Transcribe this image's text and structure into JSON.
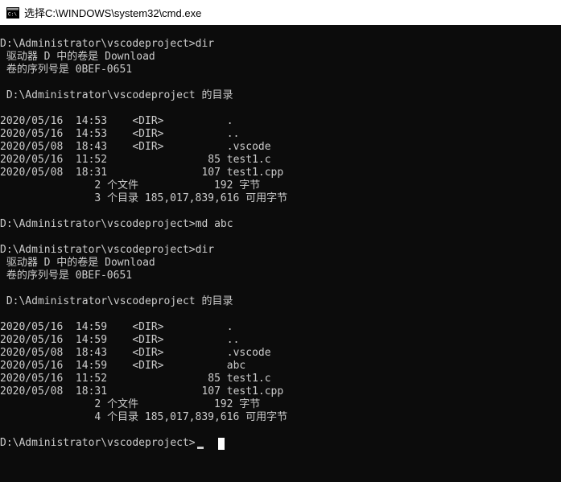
{
  "window": {
    "title": "选择C:\\WINDOWS\\system32\\cmd.exe",
    "icon": "cmd-app-icon"
  },
  "console": {
    "lines": [
      "D:\\Administrator\\vscodeproject>dir",
      " 驱动器 D 中的卷是 Download",
      " 卷的序列号是 0BEF-0651",
      "",
      " D:\\Administrator\\vscodeproject 的目录",
      "",
      "2020/05/16  14:53    <DIR>          .",
      "2020/05/16  14:53    <DIR>          ..",
      "2020/05/08  18:43    <DIR>          .vscode",
      "2020/05/16  11:52                85 test1.c",
      "2020/05/08  18:31               107 test1.cpp",
      "               2 个文件            192 字节",
      "               3 个目录 185,017,839,616 可用字节",
      "",
      "D:\\Administrator\\vscodeproject>md abc",
      "",
      "D:\\Administrator\\vscodeproject>dir",
      " 驱动器 D 中的卷是 Download",
      " 卷的序列号是 0BEF-0651",
      "",
      " D:\\Administrator\\vscodeproject 的目录",
      "",
      "2020/05/16  14:59    <DIR>          .",
      "2020/05/16  14:59    <DIR>          ..",
      "2020/05/08  18:43    <DIR>          .vscode",
      "2020/05/16  14:59    <DIR>          abc",
      "2020/05/16  11:52                85 test1.c",
      "2020/05/08  18:31               107 test1.cpp",
      "               2 个文件            192 字节",
      "               4 个目录 185,017,839,616 可用字节",
      ""
    ],
    "prompt": "D:\\Administrator\\vscodeproject>"
  }
}
